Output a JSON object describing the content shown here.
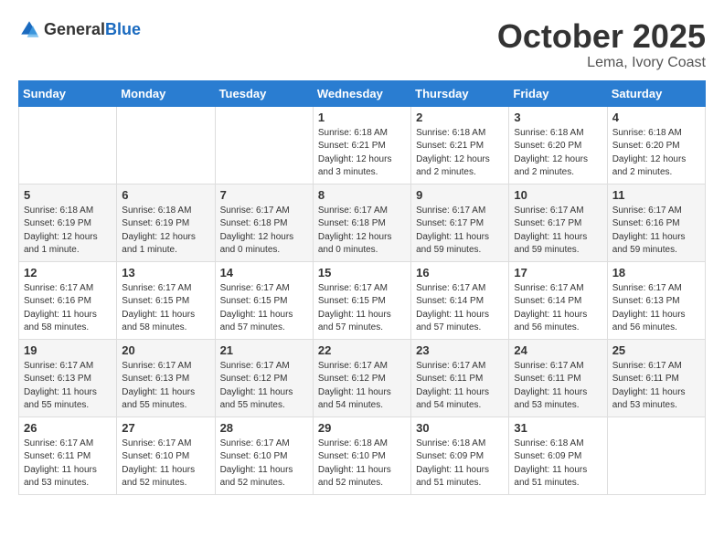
{
  "header": {
    "logo_general": "General",
    "logo_blue": "Blue",
    "month": "October 2025",
    "location": "Lema, Ivory Coast"
  },
  "days_of_week": [
    "Sunday",
    "Monday",
    "Tuesday",
    "Wednesday",
    "Thursday",
    "Friday",
    "Saturday"
  ],
  "weeks": [
    [
      {
        "day": "",
        "info": ""
      },
      {
        "day": "",
        "info": ""
      },
      {
        "day": "",
        "info": ""
      },
      {
        "day": "1",
        "info": "Sunrise: 6:18 AM\nSunset: 6:21 PM\nDaylight: 12 hours and 3 minutes."
      },
      {
        "day": "2",
        "info": "Sunrise: 6:18 AM\nSunset: 6:21 PM\nDaylight: 12 hours and 2 minutes."
      },
      {
        "day": "3",
        "info": "Sunrise: 6:18 AM\nSunset: 6:20 PM\nDaylight: 12 hours and 2 minutes."
      },
      {
        "day": "4",
        "info": "Sunrise: 6:18 AM\nSunset: 6:20 PM\nDaylight: 12 hours and 2 minutes."
      }
    ],
    [
      {
        "day": "5",
        "info": "Sunrise: 6:18 AM\nSunset: 6:19 PM\nDaylight: 12 hours and 1 minute."
      },
      {
        "day": "6",
        "info": "Sunrise: 6:18 AM\nSunset: 6:19 PM\nDaylight: 12 hours and 1 minute."
      },
      {
        "day": "7",
        "info": "Sunrise: 6:17 AM\nSunset: 6:18 PM\nDaylight: 12 hours and 0 minutes."
      },
      {
        "day": "8",
        "info": "Sunrise: 6:17 AM\nSunset: 6:18 PM\nDaylight: 12 hours and 0 minutes."
      },
      {
        "day": "9",
        "info": "Sunrise: 6:17 AM\nSunset: 6:17 PM\nDaylight: 11 hours and 59 minutes."
      },
      {
        "day": "10",
        "info": "Sunrise: 6:17 AM\nSunset: 6:17 PM\nDaylight: 11 hours and 59 minutes."
      },
      {
        "day": "11",
        "info": "Sunrise: 6:17 AM\nSunset: 6:16 PM\nDaylight: 11 hours and 59 minutes."
      }
    ],
    [
      {
        "day": "12",
        "info": "Sunrise: 6:17 AM\nSunset: 6:16 PM\nDaylight: 11 hours and 58 minutes."
      },
      {
        "day": "13",
        "info": "Sunrise: 6:17 AM\nSunset: 6:15 PM\nDaylight: 11 hours and 58 minutes."
      },
      {
        "day": "14",
        "info": "Sunrise: 6:17 AM\nSunset: 6:15 PM\nDaylight: 11 hours and 57 minutes."
      },
      {
        "day": "15",
        "info": "Sunrise: 6:17 AM\nSunset: 6:15 PM\nDaylight: 11 hours and 57 minutes."
      },
      {
        "day": "16",
        "info": "Sunrise: 6:17 AM\nSunset: 6:14 PM\nDaylight: 11 hours and 57 minutes."
      },
      {
        "day": "17",
        "info": "Sunrise: 6:17 AM\nSunset: 6:14 PM\nDaylight: 11 hours and 56 minutes."
      },
      {
        "day": "18",
        "info": "Sunrise: 6:17 AM\nSunset: 6:13 PM\nDaylight: 11 hours and 56 minutes."
      }
    ],
    [
      {
        "day": "19",
        "info": "Sunrise: 6:17 AM\nSunset: 6:13 PM\nDaylight: 11 hours and 55 minutes."
      },
      {
        "day": "20",
        "info": "Sunrise: 6:17 AM\nSunset: 6:13 PM\nDaylight: 11 hours and 55 minutes."
      },
      {
        "day": "21",
        "info": "Sunrise: 6:17 AM\nSunset: 6:12 PM\nDaylight: 11 hours and 55 minutes."
      },
      {
        "day": "22",
        "info": "Sunrise: 6:17 AM\nSunset: 6:12 PM\nDaylight: 11 hours and 54 minutes."
      },
      {
        "day": "23",
        "info": "Sunrise: 6:17 AM\nSunset: 6:11 PM\nDaylight: 11 hours and 54 minutes."
      },
      {
        "day": "24",
        "info": "Sunrise: 6:17 AM\nSunset: 6:11 PM\nDaylight: 11 hours and 53 minutes."
      },
      {
        "day": "25",
        "info": "Sunrise: 6:17 AM\nSunset: 6:11 PM\nDaylight: 11 hours and 53 minutes."
      }
    ],
    [
      {
        "day": "26",
        "info": "Sunrise: 6:17 AM\nSunset: 6:11 PM\nDaylight: 11 hours and 53 minutes."
      },
      {
        "day": "27",
        "info": "Sunrise: 6:17 AM\nSunset: 6:10 PM\nDaylight: 11 hours and 52 minutes."
      },
      {
        "day": "28",
        "info": "Sunrise: 6:17 AM\nSunset: 6:10 PM\nDaylight: 11 hours and 52 minutes."
      },
      {
        "day": "29",
        "info": "Sunrise: 6:18 AM\nSunset: 6:10 PM\nDaylight: 11 hours and 52 minutes."
      },
      {
        "day": "30",
        "info": "Sunrise: 6:18 AM\nSunset: 6:09 PM\nDaylight: 11 hours and 51 minutes."
      },
      {
        "day": "31",
        "info": "Sunrise: 6:18 AM\nSunset: 6:09 PM\nDaylight: 11 hours and 51 minutes."
      },
      {
        "day": "",
        "info": ""
      }
    ]
  ]
}
